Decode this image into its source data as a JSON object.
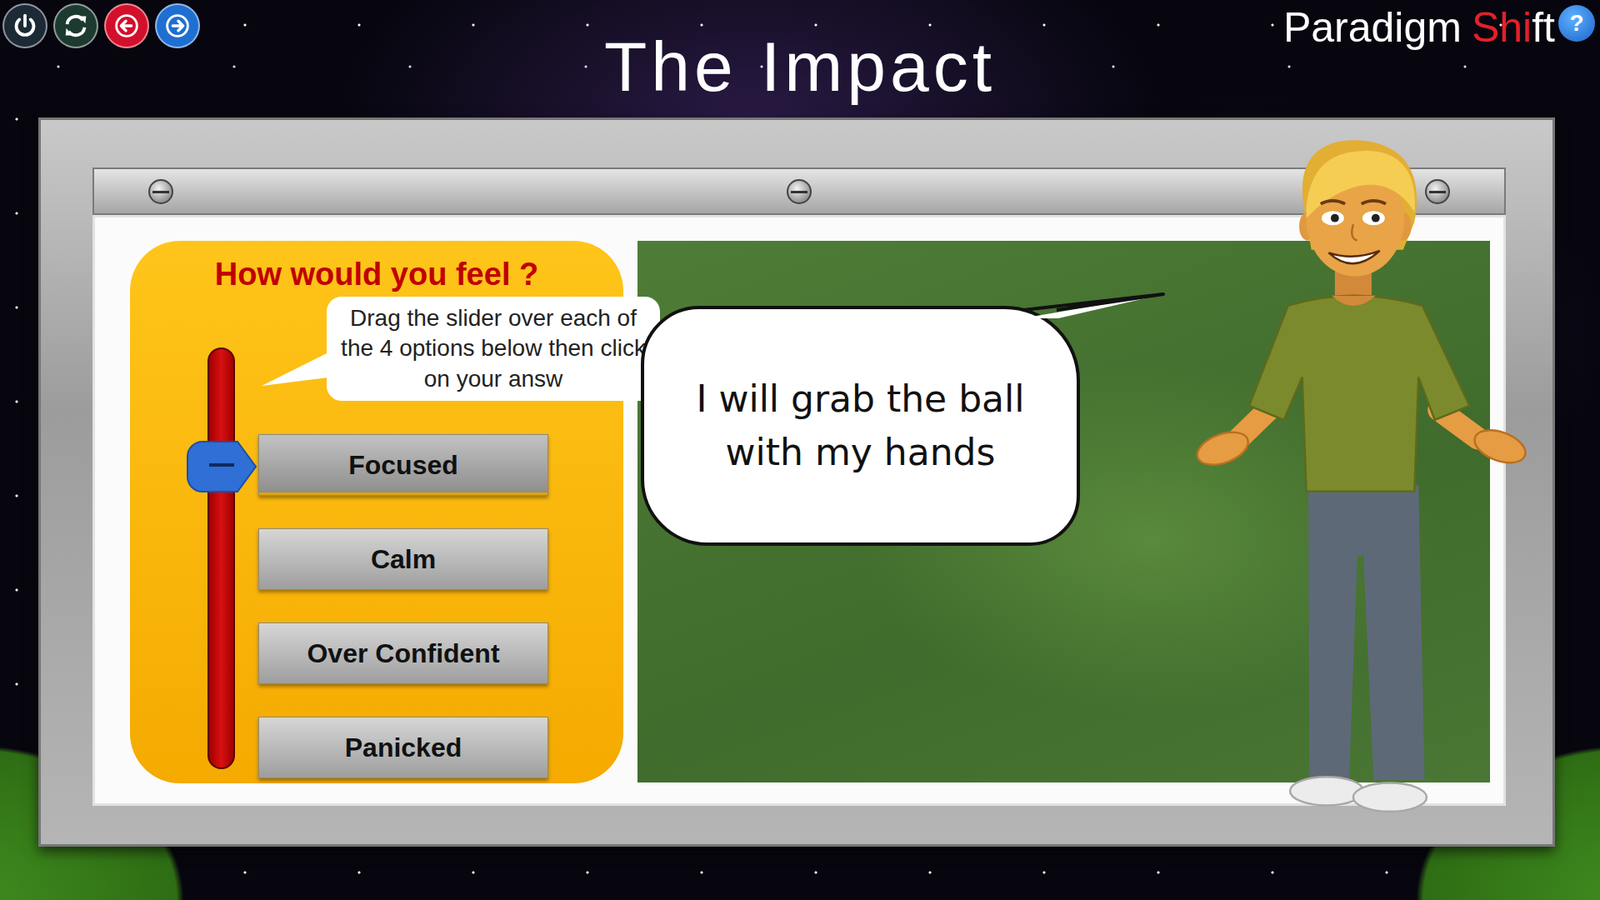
{
  "title": "The Impact",
  "nav_buttons": [
    {
      "kind": "power",
      "color": "#1c2a36"
    },
    {
      "kind": "refresh",
      "color": "#1d3a31"
    },
    {
      "kind": "back",
      "color": "#d3102b"
    },
    {
      "kind": "forward",
      "color": "#1f6fd1"
    }
  ],
  "logo": {
    "first": "Paradigm",
    "accent": "Shi",
    "rest": "ft"
  },
  "help": {
    "label": "?"
  },
  "question": {
    "heading": "How would you feel ?",
    "hint": "Drag the slider over each of the 4 options below then click on your answ",
    "slider": {
      "level": 0.72
    },
    "options": [
      {
        "label": "Focused",
        "selected": true
      },
      {
        "label": "Calm",
        "selected": false
      },
      {
        "label": "Over Confident",
        "selected": false
      },
      {
        "label": "Panicked",
        "selected": false
      }
    ]
  },
  "speech": "I will grab the ball with my hands"
}
